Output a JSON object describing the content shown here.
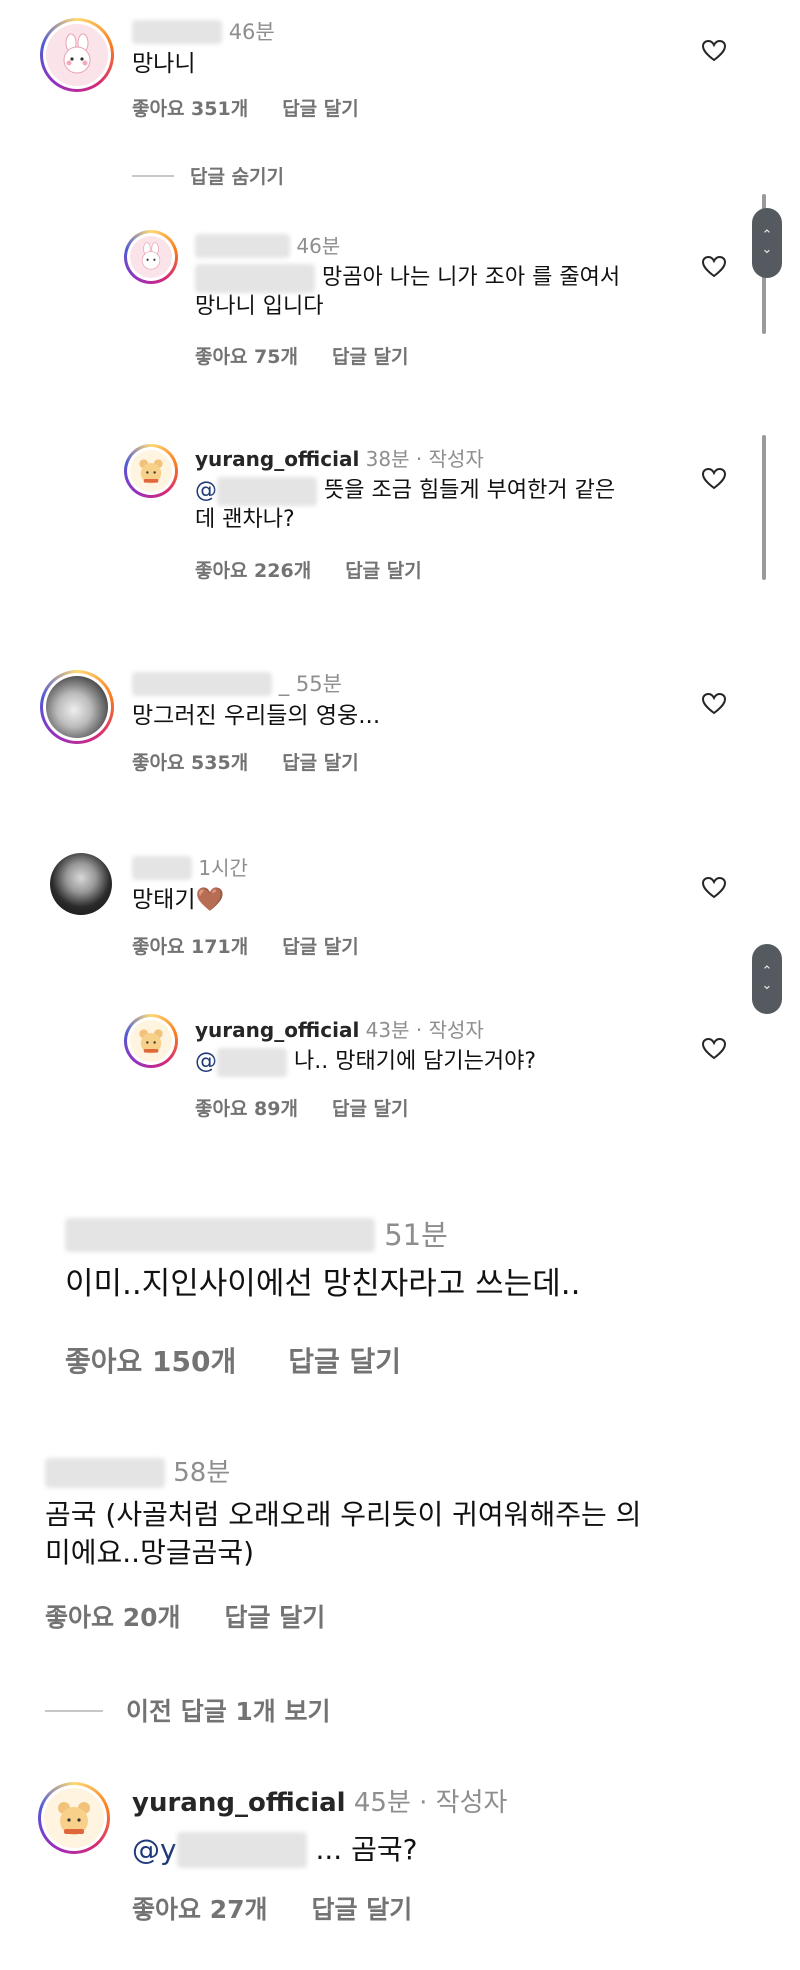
{
  "comments": [
    {
      "time": "46분",
      "text": "망나니",
      "likes": "좋아요 351개",
      "reply": "답글 달기"
    },
    {
      "hide_label": "답글 숨기기"
    },
    {
      "time": "46분",
      "text": "망곰아 나는 니가 조아 를 줄여서",
      "text2": "망나니 입니다",
      "likes": "좋아요 75개",
      "reply": "답글 달기"
    },
    {
      "user": "yurang_official",
      "time": "38분 · 작성자",
      "mention": "@",
      "text": "뜻을 조금 힘들게 부여한거 같은",
      "text2": "데 괜차나?",
      "likes": "좋아요 226개",
      "reply": "답글 달기"
    },
    {
      "time": "_ 55분",
      "text": "망그러진 우리들의 영웅...",
      "likes": "좋아요 535개",
      "reply": "답글 달기"
    },
    {
      "time": "1시간",
      "text": "망태기",
      "emoji": "🤎",
      "likes": "좋아요 171개",
      "reply": "답글 달기"
    },
    {
      "user": "yurang_official",
      "time": "43분 · 작성자",
      "mention": "@",
      "text": "나.. 망태기에 담기는거야?",
      "likes": "좋아요 89개",
      "reply": "답글 달기"
    },
    {
      "time": "51분",
      "text": "이미..지인사이에선 망친자라고 쓰는데..",
      "likes": "좋아요 150개",
      "reply": "답글 달기"
    },
    {
      "time": "58분",
      "text": "곰국 (사골처럼 오래오래 우리듯이 귀여워해주는 의",
      "text2": "미에요..망글곰국)",
      "likes": "좋아요 20개",
      "reply": "답글 달기"
    },
    {
      "prev_label": "이전 답글 1개 보기"
    },
    {
      "user": "yurang_official",
      "time": "45분 · 작성자",
      "mention": "@y",
      "text": "... 곰국?",
      "likes": "좋아요 27개",
      "reply": "답글 달기"
    }
  ],
  "scroll_up": "⌃",
  "scroll_down": "⌄",
  "icons": {
    "heart": "heart-icon",
    "avatar_bunny": "bunny-avatar",
    "avatar_bear": "bear-avatar"
  }
}
